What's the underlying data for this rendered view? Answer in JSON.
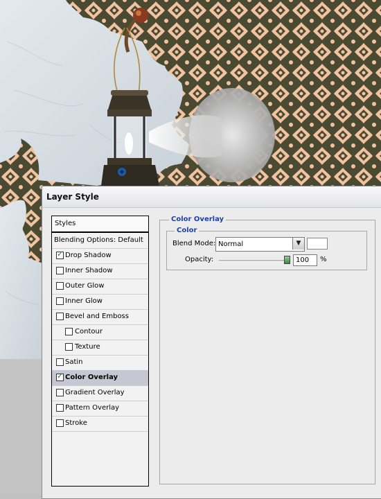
{
  "dialog": {
    "title": "Layer Style"
  },
  "styles_panel": {
    "header": "Styles",
    "blending_options": "Blending Options: Default",
    "items": [
      {
        "label": "Drop Shadow",
        "checked": true
      },
      {
        "label": "Inner Shadow",
        "checked": false
      },
      {
        "label": "Outer Glow",
        "checked": false
      },
      {
        "label": "Inner Glow",
        "checked": false
      },
      {
        "label": "Bevel and Emboss",
        "checked": false
      },
      {
        "label": "Contour",
        "checked": false
      },
      {
        "label": "Texture",
        "checked": false
      },
      {
        "label": "Satin",
        "checked": false
      },
      {
        "label": "Color Overlay",
        "checked": true,
        "selected": true
      },
      {
        "label": "Gradient Overlay",
        "checked": false
      },
      {
        "label": "Pattern Overlay",
        "checked": false
      },
      {
        "label": "Stroke",
        "checked": false
      }
    ]
  },
  "color_overlay": {
    "section_title": "Color Overlay",
    "group_title": "Color",
    "blend_mode_label": "Blend Mode:",
    "blend_mode_value": "Normal",
    "overlay_color": "#ffffff",
    "opacity_label": "Opacity:",
    "opacity_value": "100",
    "opacity_unit": "%"
  },
  "colors": {
    "accent_blue": "#1c3fae",
    "wallpaper_dark": "#4a4a33",
    "wallpaper_light": "#f2c3a0",
    "plaster": "#d8e0e6",
    "selected_row": "#c6c7d2"
  }
}
